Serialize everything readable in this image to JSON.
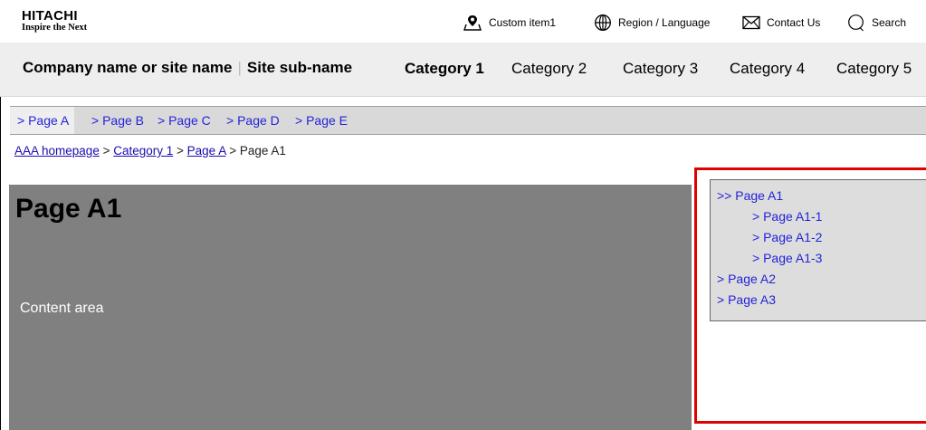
{
  "header": {
    "logo": {
      "main": "HITACHI",
      "tagline": "Inspire the Next"
    },
    "utility": {
      "custom_item": "Custom item1",
      "region": "Region / Language",
      "contact": "Contact Us",
      "search": "Search"
    }
  },
  "nav": {
    "site_name": "Company name or site name",
    "separator": "|",
    "site_subname": "Site sub-name",
    "categories": [
      {
        "label": "Category 1",
        "active": true
      },
      {
        "label": "Category 2",
        "active": false
      },
      {
        "label": "Category 3",
        "active": false
      },
      {
        "label": "Category 4",
        "active": false
      },
      {
        "label": "Category 5",
        "active": false
      }
    ]
  },
  "subnav": {
    "items": [
      {
        "label": "> Page A",
        "active": true
      },
      {
        "label": "> Page B",
        "active": false
      },
      {
        "label": "> Page C",
        "active": false
      },
      {
        "label": "> Page D",
        "active": false
      },
      {
        "label": "> Page E",
        "active": false
      }
    ]
  },
  "breadcrumb": {
    "items": [
      "AAA homepage",
      "Category 1",
      "Page A"
    ],
    "separator": " > ",
    "current": "Page A1"
  },
  "content": {
    "title": "Page A1",
    "text": "Content area"
  },
  "sidenav": {
    "items": [
      {
        "label": ">> Page A1",
        "level": 1
      },
      {
        "label": "> Page A1-1",
        "level": 2
      },
      {
        "label": "> Page A1-2",
        "level": 2
      },
      {
        "label": "> Page A1-3",
        "level": 2
      },
      {
        "label": "> Page A2",
        "level": 1
      },
      {
        "label": "> Page A3",
        "level": 1
      }
    ]
  },
  "colors": {
    "link": "#2323d9",
    "highlight_border": "#e00000",
    "content_bg": "#808080",
    "nav_bg": "#eeeeee",
    "subnav_bg": "#d9d9d9"
  }
}
